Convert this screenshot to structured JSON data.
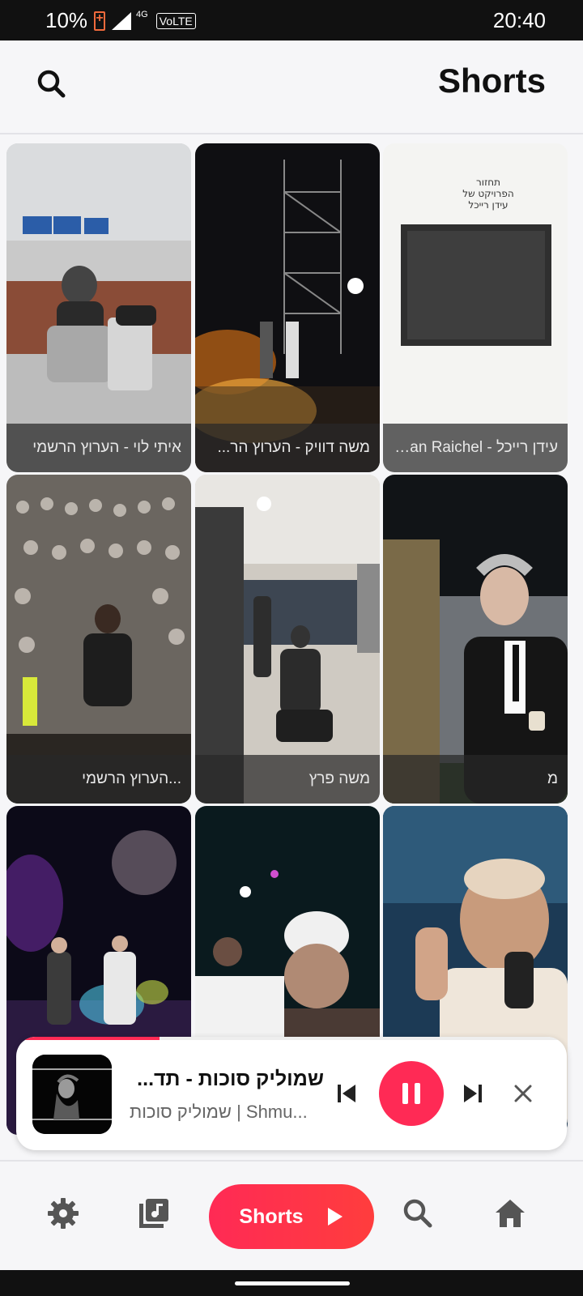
{
  "status_bar": {
    "battery": "10%",
    "network": "4G",
    "volte": "VoLTE",
    "time": "20:40"
  },
  "header": {
    "title": "Shorts",
    "search_icon": "search-icon"
  },
  "shorts": [
    {
      "caption": "איתי לוי - הערוץ הרשמי"
    },
    {
      "caption": "משה דוויק - הערוץ הר..."
    },
    {
      "caption": "עידן רייכל - Idan Raichel..."
    },
    {
      "caption": "...הערוץ הרשמי"
    },
    {
      "caption": "משה פרץ"
    },
    {
      "caption": "מ"
    },
    {
      "caption": ""
    },
    {
      "caption": ""
    },
    {
      "caption": ""
    }
  ],
  "player": {
    "title": "שמוליק סוכות - תד...",
    "subtitle": "שמוליק סוכות | Shmu...",
    "progress": 0.26,
    "accent": "#ff2a55"
  },
  "bottom_nav": {
    "settings_icon": "gear-icon",
    "library_icon": "music-library-icon",
    "shorts_label": "Shorts",
    "search_icon": "search-icon",
    "home_icon": "home-icon"
  }
}
